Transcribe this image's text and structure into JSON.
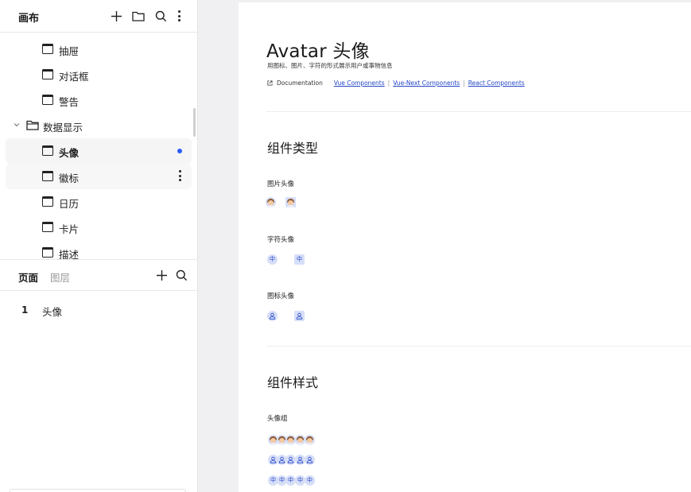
{
  "sidebar": {
    "title": "画布",
    "tree": [
      {
        "label": "抽屉",
        "type": "page"
      },
      {
        "label": "对话框",
        "type": "page"
      },
      {
        "label": "警告",
        "type": "page"
      },
      {
        "label": "数据显示",
        "type": "folder"
      },
      {
        "label": "头像",
        "type": "page",
        "state": "active"
      },
      {
        "label": "徽标",
        "type": "page",
        "state": "hover"
      },
      {
        "label": "日历",
        "type": "page"
      },
      {
        "label": "卡片",
        "type": "page"
      },
      {
        "label": "描述",
        "type": "page"
      }
    ],
    "tabs": [
      {
        "label": "页面",
        "active": true
      },
      {
        "label": "图层",
        "active": false
      }
    ],
    "pages": [
      {
        "num": "1",
        "name": "头像"
      }
    ]
  },
  "doc": {
    "title": "Avatar 头像",
    "subtitle": "用图标、图片、字符的形式展示用户或事物信息",
    "doc_link": "Documentation",
    "links": [
      "Vue Components",
      "Vue-Next Components",
      "React Components"
    ],
    "section1": {
      "heading": "组件类型",
      "groups": [
        {
          "label": "图片头像",
          "kind": "image"
        },
        {
          "label": "字符头像",
          "kind": "char",
          "char": "中"
        },
        {
          "label": "图标头像",
          "kind": "icon"
        }
      ]
    },
    "section2": {
      "heading": "组件样式",
      "group_label": "头像组",
      "char": "中"
    }
  },
  "colors": {
    "accent": "#2b5cf6",
    "avatar_bg": "#d6def8",
    "link": "#2446c8"
  }
}
